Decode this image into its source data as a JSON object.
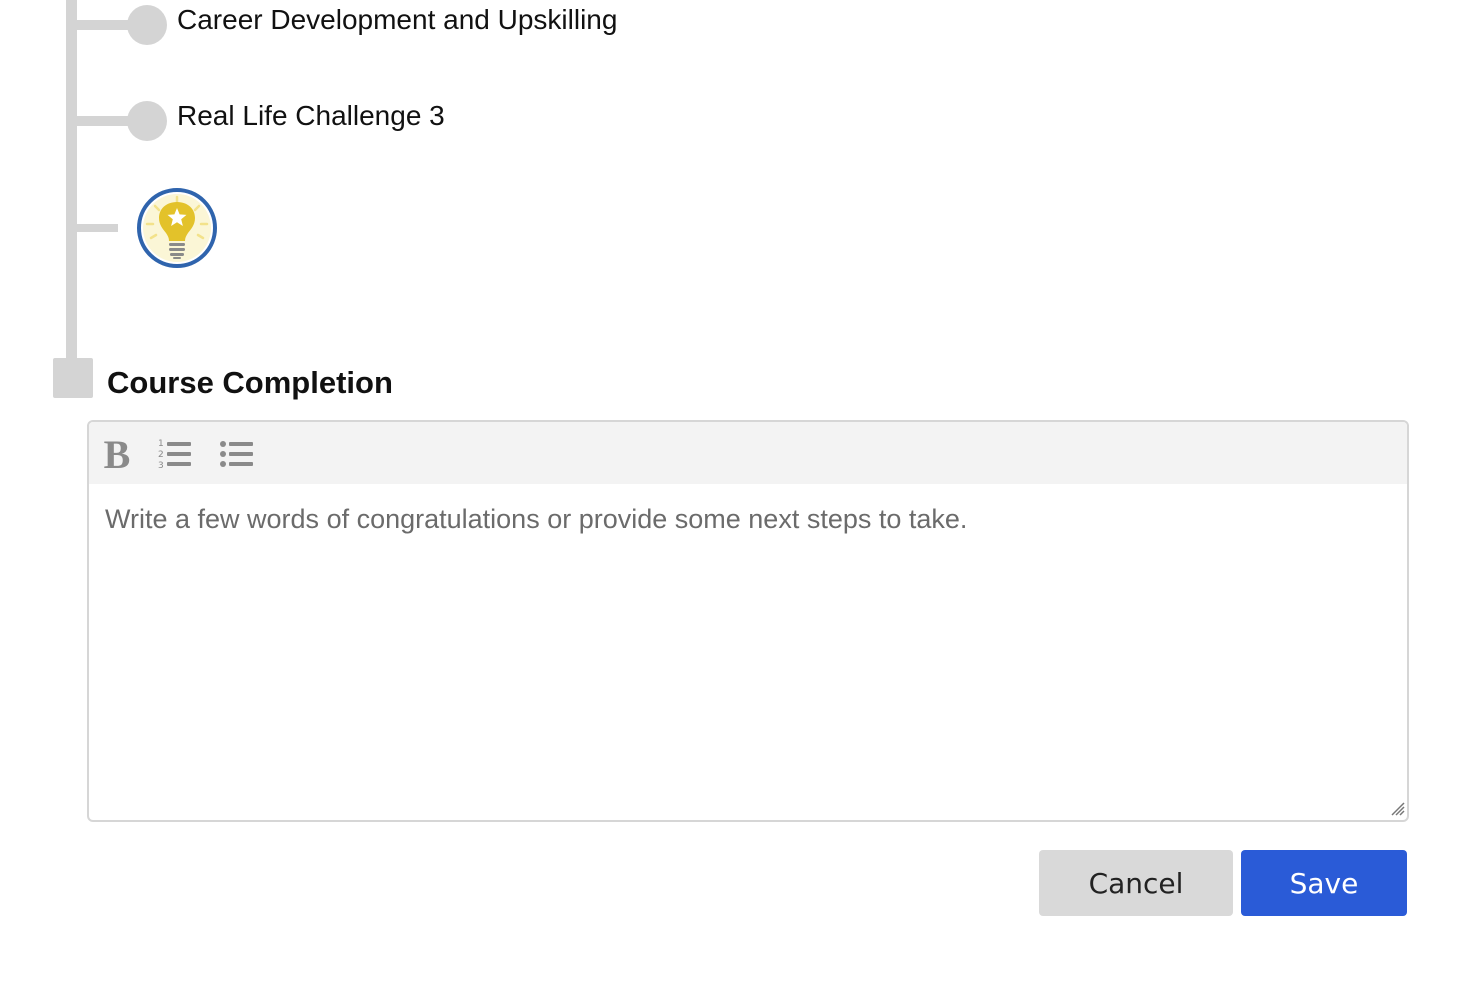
{
  "timeline": {
    "items": [
      {
        "label": "Career Development and Upskilling"
      },
      {
        "label": "Real Life Challenge 3"
      }
    ],
    "badge_icon": "lightbulb-star-badge-icon"
  },
  "course_completion": {
    "title": "Course Completion",
    "editor": {
      "placeholder": "Write a few words of congratulations or provide some next steps to take.",
      "toolbar": {
        "bold_label": "B",
        "bold_icon": "bold-icon",
        "ordered_list_icon": "numbered-list-icon",
        "bullet_list_icon": "bulleted-list-icon"
      }
    }
  },
  "actions": {
    "cancel_label": "Cancel",
    "save_label": "Save"
  },
  "colors": {
    "primary": "#2a5bd7",
    "timeline_gray": "#d4d4d4",
    "badge_ring": "#2f64ad",
    "badge_bulb": "#e3c22a"
  }
}
